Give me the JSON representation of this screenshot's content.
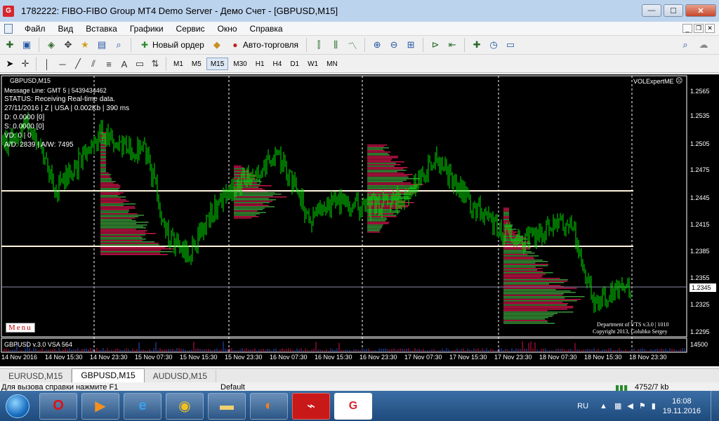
{
  "window": {
    "title": "1782222: FIBO-FIBO Group MT4 Demo Server - Демо Счет - [GBPUSD,M15]",
    "app_icon_letter": "G",
    "minimize_glyph": "—",
    "maximize_glyph": "☐",
    "close_glyph": "✕"
  },
  "menu": {
    "items": [
      "Файл",
      "Вид",
      "Вставка",
      "Графики",
      "Сервис",
      "Окно",
      "Справка"
    ]
  },
  "toolbar": {
    "new_order_label": "Новый ордер",
    "autotrading_label": "Авто-торговля"
  },
  "timeframes": [
    "M1",
    "M5",
    "M15",
    "M30",
    "H1",
    "H4",
    "D1",
    "W1",
    "MN"
  ],
  "active_timeframe": "M15",
  "chart": {
    "symbol_title": "GBPUSD,M15",
    "message_line": "Message Line: GMT 5 | 5439434462",
    "status_line": "STATUS:  Receiving Real-time data.",
    "date_line": "27/11/2016 | Z | USA | 0.002Kb | 390 ms",
    "d_line": "D: 0.0000  [0]",
    "s_line": "S: 0.0000  [0]",
    "vd_line": "VD: 0 | 0",
    "ad_line": "A/D: 2839 | A/W: 7495",
    "expert_label": "VOLExpertME",
    "menu_button": "Menu",
    "copyright_1": "Department of VTS  v.3.0 | 1010",
    "copyright_2": "Copyright 2013, Golubko Sergey",
    "subwindow_label": "GBPUSD v.3.0 VSA 564",
    "subwindow_scale": "14500",
    "current_price": "1.2345",
    "price_labels": [
      "1.2565",
      "1.2535",
      "1.2505",
      "1.2475",
      "1.2445",
      "1.2415",
      "1.2385",
      "1.2355",
      "1.2325",
      "1.2295"
    ],
    "time_labels": [
      "14 Nov 2016",
      "14 Nov 15:30",
      "14 Nov 23:30",
      "15 Nov 07:30",
      "15 Nov 15:30",
      "15 Nov 23:30",
      "16 Nov 07:30",
      "16 Nov 15:30",
      "16 Nov 23:30",
      "17 Nov 07:30",
      "17 Nov 15:30",
      "17 Nov 23:30",
      "18 Nov 07:30",
      "18 Nov 15:30",
      "18 Nov 23:30"
    ],
    "colors": {
      "candles": "#00e000",
      "profile_bull": "#3ca03c",
      "profile_bear": "#d2144b",
      "level_line": "#fff5dc",
      "background": "#000000"
    }
  },
  "tabs": [
    "EURUSD,M15",
    "GBPUSD,M15",
    "AUDUSD,M15"
  ],
  "active_tab": "GBPUSD,M15",
  "status": {
    "help": "Для вызова справки нажмите F1",
    "profile": "Default",
    "traffic": "4752/7 kb"
  },
  "taskbar": {
    "lang": "RU",
    "time": "16:08",
    "date": "19.11.2016"
  }
}
